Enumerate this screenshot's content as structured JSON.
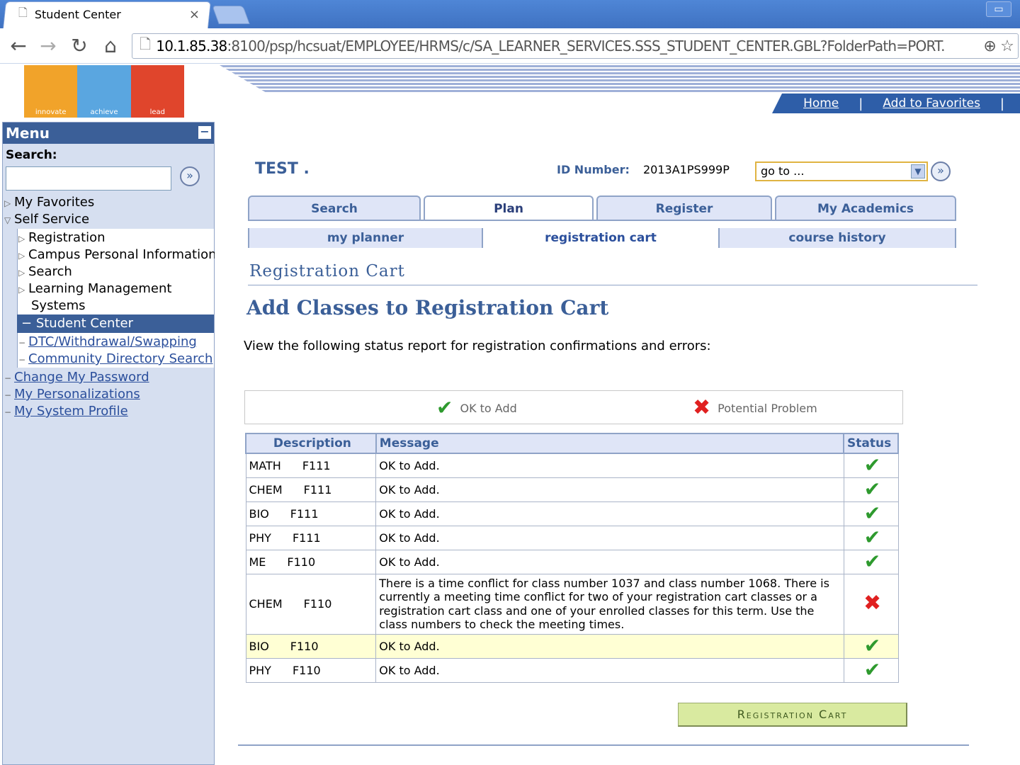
{
  "browser": {
    "tab_title": "Student Center",
    "tab_close": "×",
    "url_host": "10.1.85.38",
    "url_rest": ":8100/psp/hcsuat/EMPLOYEE/HRMS/c/SA_LEARNER_SERVICES.SSS_STUDENT_CENTER.GBL?FolderPath=PORT."
  },
  "logo": {
    "labels": [
      "innovate",
      "achieve",
      "lead"
    ],
    "colors": [
      "#f1a32a",
      "#5aa6e0",
      "#e0452c"
    ]
  },
  "header_links": {
    "home": "Home",
    "favorites": "Add to Favorites",
    "sep": "|"
  },
  "menu": {
    "title": "Menu",
    "search_label": "Search:",
    "items": [
      {
        "label": "My Favorites"
      },
      {
        "label": "Self Service"
      },
      {
        "label": "Registration"
      },
      {
        "label": "Campus Personal Information"
      },
      {
        "label": "Search"
      },
      {
        "label": "Learning Management"
      },
      {
        "label": "Systems"
      },
      {
        "label": "Student Center"
      },
      {
        "label": "DTC/Withdrawal/Swapping"
      },
      {
        "label": "Community Directory Search"
      },
      {
        "label": "Change My Password"
      },
      {
        "label": "My Personalizations"
      },
      {
        "label": "My System Profile"
      }
    ]
  },
  "student": {
    "name": "TEST .",
    "id_label": "ID Number:",
    "id_value": "2013A1PS999P",
    "goto_value": "go to ..."
  },
  "tabs": [
    {
      "label": "Search"
    },
    {
      "label": "Plan"
    },
    {
      "label": "Register"
    },
    {
      "label": "My Academics"
    }
  ],
  "subtabs": [
    {
      "label": "my planner"
    },
    {
      "label": "registration cart"
    },
    {
      "label": "course history"
    }
  ],
  "page": {
    "title": "Registration Cart",
    "section_title": "Add Classes to Registration Cart",
    "intro": "View the following status report for registration confirmations and errors:",
    "legend_ok": "OK to Add",
    "legend_problem": "Potential Problem",
    "button_label": "Registration Cart"
  },
  "table": {
    "headers": [
      "Description",
      "Message",
      "Status"
    ],
    "rows": [
      {
        "subject": "MATH",
        "course": "F111",
        "message": "OK to Add.",
        "status": "ok"
      },
      {
        "subject": "CHEM",
        "course": "F111",
        "message": "OK to Add.",
        "status": "ok"
      },
      {
        "subject": "BIO",
        "course": "F111",
        "message": "OK to Add.",
        "status": "ok"
      },
      {
        "subject": "PHY",
        "course": "F111",
        "message": "OK to Add.",
        "status": "ok"
      },
      {
        "subject": "ME",
        "course": "F110",
        "message": "OK to Add.",
        "status": "ok"
      },
      {
        "subject": "CHEM",
        "course": "F110",
        "message": "There is a time conflict for class number 1037 and class number 1068. There is currently a meeting time conflict for two of your registration cart classes or a registration cart class and one of your enrolled classes for this term. Use the class numbers to check the meeting times.",
        "status": "problem"
      },
      {
        "subject": "BIO",
        "course": "F110",
        "message": "OK to Add.",
        "status": "ok"
      },
      {
        "subject": "PHY",
        "course": "F110",
        "message": "OK to Add.",
        "status": "ok"
      }
    ]
  },
  "colors": {
    "menu_head": "#3b5f98",
    "tab_bg": "#dfe5f7",
    "ok": "#2e9a2e",
    "problem": "#e02020",
    "highlight_row": "#ffffd4"
  },
  "icons": {
    "check": "check-icon",
    "cross": "cross-icon",
    "go": "go-arrow-icon"
  }
}
